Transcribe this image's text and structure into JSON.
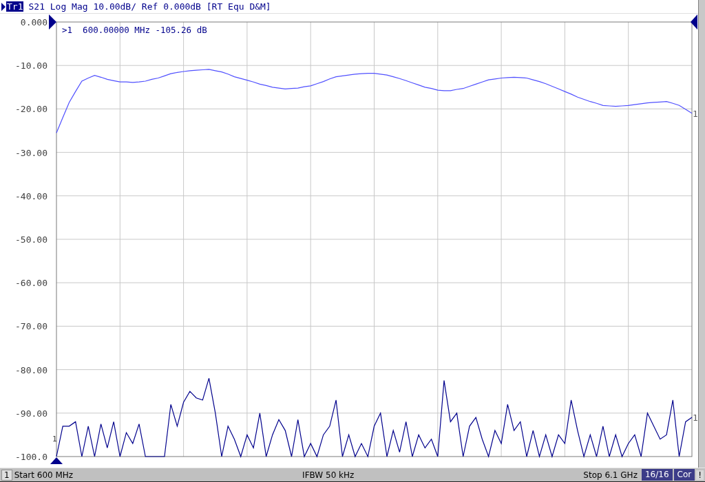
{
  "trace_header": {
    "trace_label": "Tr1",
    "selected": true,
    "text": "S21 Log Mag 10.00dB/ Ref 0.000dB [RT Equ D&M]"
  },
  "chart": {
    "marker_readout": ">1  600.00000 MHz -105.26 dB",
    "marker_flag": "1",
    "trace_end_labels": [
      "1",
      "1"
    ],
    "chart_data": {
      "type": "line",
      "grid": true,
      "ylim": [
        -100,
        0
      ],
      "yticks": [
        {
          "value": 0,
          "label": "0.000"
        },
        {
          "value": -10,
          "label": "-10.00"
        },
        {
          "value": -20,
          "label": "-20.00"
        },
        {
          "value": -30,
          "label": "-30.00"
        },
        {
          "value": -40,
          "label": "-40.00"
        },
        {
          "value": -50,
          "label": "-50.00"
        },
        {
          "value": -60,
          "label": "-60.00"
        },
        {
          "value": -70,
          "label": "-70.00"
        },
        {
          "value": -80,
          "label": "-80.00"
        },
        {
          "value": -90,
          "label": "-90.00"
        },
        {
          "value": -100,
          "label": "-100.0"
        }
      ],
      "categories": [
        null,
        null,
        null,
        null,
        null,
        null,
        null,
        null,
        null,
        null,
        null,
        null,
        null,
        null,
        null,
        null,
        null,
        null,
        null,
        null,
        null,
        null,
        null,
        null,
        null,
        null,
        null,
        null,
        null,
        null,
        null,
        null,
        null,
        null,
        null,
        null,
        null,
        null,
        null,
        null,
        null,
        null,
        null,
        null,
        null,
        null,
        null,
        null,
        null,
        null,
        null,
        null,
        null,
        null,
        null,
        null,
        null,
        null,
        null,
        null,
        null,
        null,
        null,
        null,
        null,
        null,
        null,
        null,
        null,
        null,
        null,
        null,
        null,
        null,
        null,
        null,
        null,
        null,
        null,
        null,
        null,
        null,
        null,
        null,
        null,
        null,
        null,
        null,
        null,
        null,
        null,
        null,
        null,
        null,
        null,
        null,
        null,
        null,
        null,
        null,
        null
      ],
      "series": [
        {
          "color": "#5050ff",
          "values": [
            -25.5,
            -22,
            -18.5,
            -16,
            -13.6,
            -12.9,
            -12.3,
            -12.7,
            -13.2,
            -13.5,
            -13.8,
            -13.8,
            -13.9,
            -13.8,
            -13.6,
            -13.2,
            -12.9,
            -12.4,
            -11.9,
            -11.6,
            -11.4,
            -11.2,
            -11.1,
            -11,
            -10.9,
            -11.2,
            -11.5,
            -12,
            -12.6,
            -13,
            -13.4,
            -13.8,
            -14.3,
            -14.6,
            -15,
            -15.2,
            -15.4,
            -15.3,
            -15.2,
            -14.9,
            -14.7,
            -14.2,
            -13.7,
            -13.1,
            -12.6,
            -12.4,
            -12.2,
            -12,
            -11.9,
            -11.8,
            -11.8,
            -12,
            -12.2,
            -12.6,
            -13,
            -13.5,
            -14,
            -14.5,
            -15,
            -15.3,
            -15.7,
            -15.8,
            -15.8,
            -15.5,
            -15.3,
            -14.8,
            -14.3,
            -13.8,
            -13.3,
            -13.1,
            -12.9,
            -12.8,
            -12.7,
            -12.8,
            -12.9,
            -13.3,
            -13.7,
            -14.2,
            -14.8,
            -15.4,
            -16,
            -16.6,
            -17.3,
            -17.8,
            -18.3,
            -18.7,
            -19.2,
            -19.3,
            -19.4,
            -19.3,
            -19.2,
            -19,
            -18.8,
            -18.6,
            -18.5,
            -18.4,
            -18.3,
            -18.7,
            -19.2,
            -20.1,
            -21
          ]
        },
        {
          "color": "#00008c",
          "values": [
            -100,
            -93,
            -93,
            -92,
            -100,
            -93,
            -100,
            -92.5,
            -98,
            -92,
            -100,
            -94.5,
            -97,
            -92.5,
            -100,
            -100,
            -100,
            -100,
            -88,
            -93,
            -87.5,
            -85,
            -86.5,
            -87,
            -82,
            -90,
            -100,
            -93,
            -96,
            -100,
            -95,
            -98,
            -90,
            -100,
            -95,
            -91.5,
            -94,
            -100,
            -91.5,
            -100,
            -97,
            -100,
            -95,
            -93,
            -87,
            -100,
            -95,
            -100,
            -97,
            -100,
            -93,
            -90,
            -100,
            -94,
            -99,
            -92,
            -100,
            -95,
            -98,
            -96,
            -100,
            -82.5,
            -92,
            -90,
            -100,
            -93,
            -91,
            -96,
            -100,
            -94,
            -97,
            -88,
            -94,
            -92,
            -100,
            -94,
            -100,
            -95,
            -100,
            -95,
            -97,
            -87,
            -94,
            -100,
            -95,
            -100,
            -93,
            -100,
            -95,
            -100,
            -97,
            -95,
            -100,
            -90,
            -93,
            -96,
            -95,
            -87,
            -100,
            -92,
            -91
          ]
        }
      ]
    }
  },
  "status_bar": {
    "channel": "1",
    "start": "Start 600 MHz",
    "ifbw": "IFBW 50 kHz",
    "stop": "Stop 6.1 GHz",
    "sweep_count": "16/16",
    "correction": "Cor",
    "warning": "!"
  }
}
